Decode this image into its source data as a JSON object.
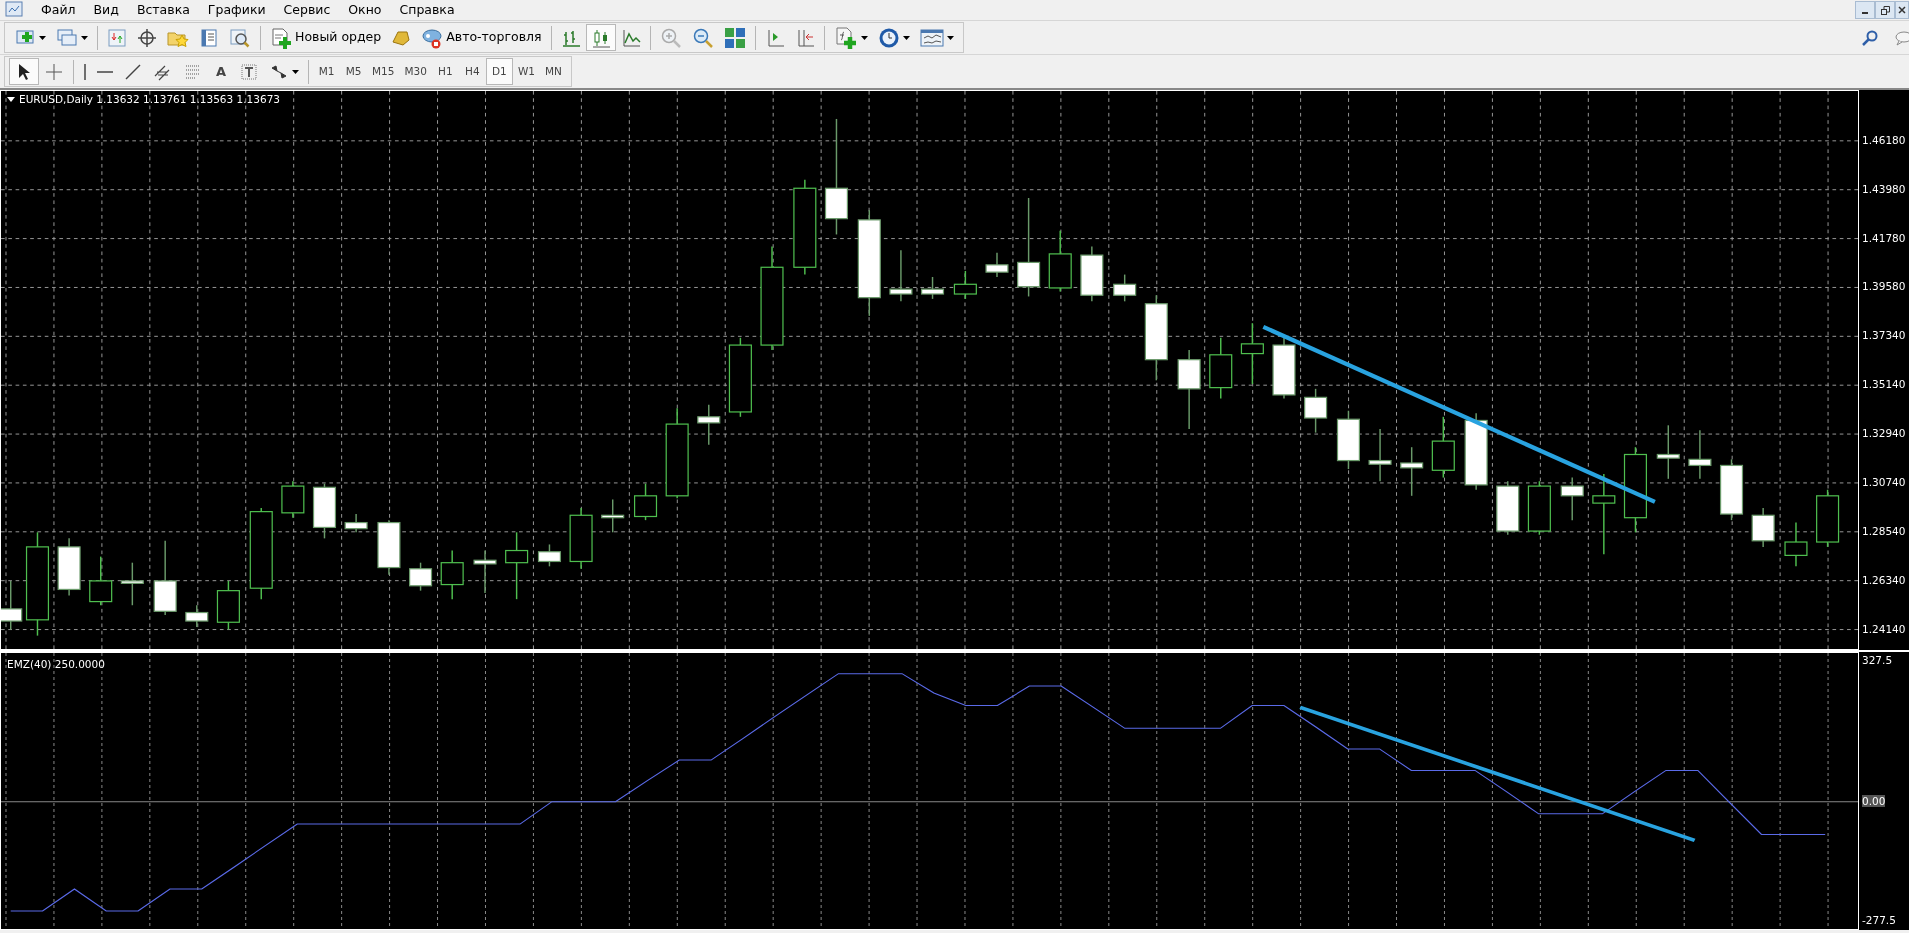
{
  "menu": [
    {
      "label": "Файл"
    },
    {
      "label": "Вид"
    },
    {
      "label": "Вставка"
    },
    {
      "label": "Графики"
    },
    {
      "label": "Сервис"
    },
    {
      "label": "Окно"
    },
    {
      "label": "Справка"
    }
  ],
  "toolbar": {
    "new_order": "Новый ордер",
    "auto_trading": "Авто-торговля",
    "chart_types": [
      {
        "selected": false
      },
      {
        "selected": true
      },
      {
        "selected": false
      }
    ]
  },
  "drawing_tools": [
    {
      "selected": true
    },
    {
      "selected": false
    },
    {
      "selected": false
    },
    {
      "selected": false
    },
    {
      "selected": false
    },
    {
      "selected": false
    },
    {
      "selected": false
    },
    {
      "selected": false,
      "label": "A"
    },
    {
      "selected": false
    },
    {
      "selected": false
    }
  ],
  "timeframes": [
    {
      "label": "M1",
      "selected": false
    },
    {
      "label": "M5",
      "selected": false
    },
    {
      "label": "M15",
      "selected": false
    },
    {
      "label": "M30",
      "selected": false
    },
    {
      "label": "H1",
      "selected": false
    },
    {
      "label": "H4",
      "selected": false
    },
    {
      "label": "D1",
      "selected": true
    },
    {
      "label": "W1",
      "selected": false
    },
    {
      "label": "MN",
      "selected": false
    }
  ],
  "chart": {
    "symbol_line": "EURUSD,Daily 1.13632 1.13761 1.13563 1.13673",
    "price_axis": [
      "1.46180",
      "1.43980",
      "1.41780",
      "1.39580",
      "1.37340",
      "1.35140",
      "1.32940",
      "1.30740",
      "1.28540",
      "1.26340",
      "1.24140"
    ],
    "indicator": {
      "chart_data": {
        "type": "line",
        "grid": true,
        "ylim": [
          -296.1,
          346.1
        ],
        "yticks": [
          {
            "value": 327.5,
            "label": "327.5"
          },
          {
            "value": 0,
            "label": "0.00"
          },
          {
            "value": -277.5,
            "label": "-277.5"
          }
        ],
        "series": [
          {
            "name": "EMZ(40) 250.0000",
            "color": "#5a6ae8",
            "values": [
              -254,
              -254,
              -203,
              -254,
              -254,
              -203,
              -203,
              -153,
              -102,
              -52,
              -52,
              -52,
              -52,
              -52,
              -52,
              -52,
              -52,
              0,
              0,
              0,
              49,
              97,
              97,
              147,
              198,
              248,
              298,
              298,
              298,
              253,
              224,
              224,
              269,
              269,
              220,
              171,
              171,
              171,
              171,
              224,
              224,
              174,
              123,
              123,
              73,
              73,
              73,
              23,
              -28,
              -28,
              -28,
              23,
              73,
              73,
              -2,
              -76,
              -76,
              -76
            ]
          }
        ]
      }
    }
  }
}
